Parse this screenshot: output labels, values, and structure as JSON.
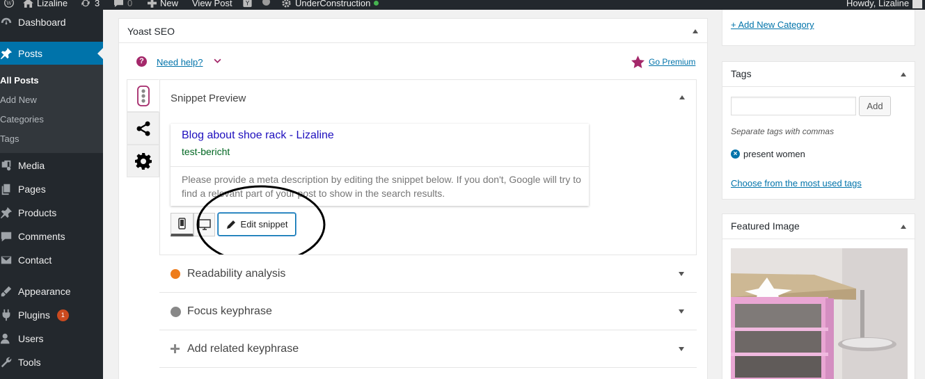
{
  "adminbar": {
    "site_name": "Lizaline",
    "updates_count": "3",
    "comments_count": "0",
    "new_label": "New",
    "view_post_label": "View Post",
    "plugin_label": "UnderConstruction",
    "greeting": "Howdy, Lizaline"
  },
  "sidebar": {
    "dashboard": "Dashboard",
    "posts": "Posts",
    "posts_sub": {
      "all_posts": "All Posts",
      "add_new": "Add New",
      "categories": "Categories",
      "tags": "Tags"
    },
    "media": "Media",
    "pages": "Pages",
    "products": "Products",
    "comments": "Comments",
    "contact": "Contact",
    "appearance": "Appearance",
    "plugins": "Plugins",
    "plugins_badge": "1",
    "users": "Users",
    "tools": "Tools"
  },
  "yoast": {
    "title": "Yoast SEO",
    "need_help": "Need help?",
    "go_premium": "Go Premium",
    "snippet_preview_label": "Snippet Preview",
    "snippet": {
      "title": "Blog about shoe rack - Lizaline",
      "url": "test-bericht",
      "description": "Please provide a meta description by editing the snippet below. If you don't, Google will try to find a relevant part of your post to show in the search results."
    },
    "edit_snippet_label": "Edit snippet",
    "sections": [
      {
        "label": "Readability analysis"
      },
      {
        "label": "Focus keyphrase"
      },
      {
        "label": "Add related keyphrase"
      }
    ]
  },
  "categories": {
    "add_new_category": "+ Add New Category"
  },
  "tags": {
    "title": "Tags",
    "input_value": "",
    "add_label": "Add",
    "hint": "Separate tags with commas",
    "tag_items": [
      "present women"
    ],
    "choose_most_used": "Choose from the most used tags"
  },
  "featured_image": {
    "title": "Featured Image"
  },
  "colors": {
    "adminbar_bg": "#23282d",
    "sidebar_active": "#0073aa",
    "link": "#0073aa",
    "yoast_purple": "#a4286a",
    "readability_dot": "#ee7c1b",
    "keyphrase_dot": "#888888",
    "snippet_title": "#1e0fbe",
    "snippet_url": "#006621"
  }
}
